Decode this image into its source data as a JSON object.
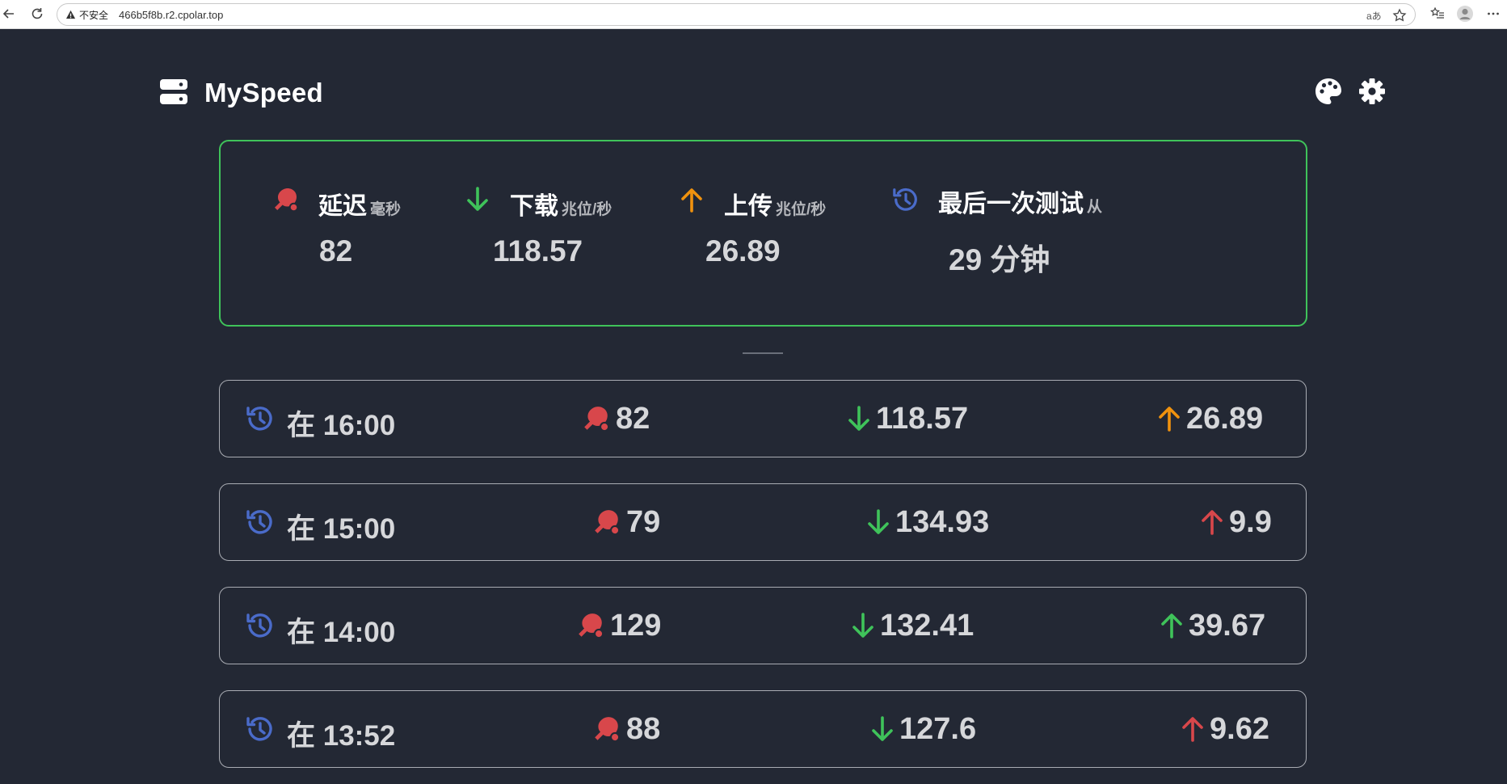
{
  "browser": {
    "security_label": "不安全",
    "url": "466b5f8b.r2.cpolar.top",
    "translate_label": "aあ"
  },
  "app": {
    "title": "MySpeed"
  },
  "summary": {
    "ping": {
      "label": "延迟",
      "unit": "毫秒",
      "value": "82"
    },
    "download": {
      "label": "下载",
      "unit": "兆位/秒",
      "value": "118.57"
    },
    "upload": {
      "label": "上传",
      "unit": "兆位/秒",
      "value": "26.89"
    },
    "last_test": {
      "label": "最后一次测试",
      "unit": "从",
      "value": "29 分钟"
    }
  },
  "history": [
    {
      "time": "在 16:00",
      "ping": "82",
      "download": "118.57",
      "upload": "26.89",
      "upload_status": "ok"
    },
    {
      "time": "在 15:00",
      "ping": "79",
      "download": "134.93",
      "upload": "9.9",
      "upload_status": "bad"
    },
    {
      "time": "在 14:00",
      "ping": "129",
      "download": "132.41",
      "upload": "39.67",
      "upload_status": "good"
    },
    {
      "time": "在 13:52",
      "ping": "88",
      "download": "127.6",
      "upload": "9.62",
      "upload_status": "bad"
    }
  ],
  "colors": {
    "background": "#232834",
    "card_border": "#3fc35a",
    "ping": "#d8474b",
    "download": "#3fc35a",
    "upload_ok": "#f0920e",
    "upload_bad": "#d8474b",
    "upload_good": "#3fc35a",
    "history_icon": "#4a6bc9"
  },
  "icons": {
    "logo": "server-icon",
    "theme": "palette-icon",
    "settings": "gear-icon",
    "ping": "ping-pong-icon",
    "download": "arrow-down-icon",
    "upload": "arrow-up-icon",
    "time": "history-icon"
  }
}
